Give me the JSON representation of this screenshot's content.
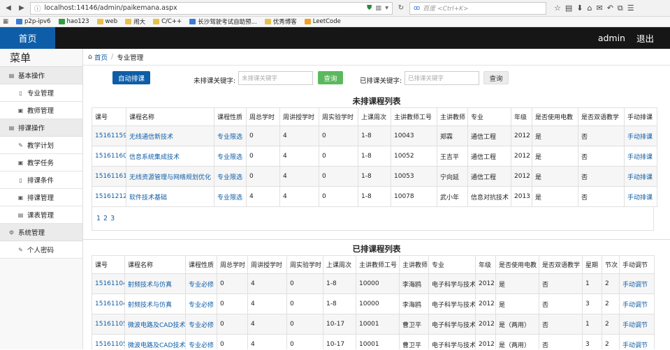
{
  "browser": {
    "url": "localhost:14146/admin/paikemana.aspx",
    "search_placeholder": "百度 <Ctrl+K>"
  },
  "bookmarks": [
    {
      "label": "p2p-ipv6",
      "color": "#3a7bd5"
    },
    {
      "label": "hao123",
      "color": "#2e9e3e"
    },
    {
      "label": "web",
      "color": "#e8c04a"
    },
    {
      "label": "闹大",
      "color": "#e8c04a"
    },
    {
      "label": "C/C++",
      "color": "#e8c04a"
    },
    {
      "label": "长沙驾驶考试自助预...",
      "color": "#3a7bd5"
    },
    {
      "label": "优秀博客",
      "color": "#e8c04a"
    },
    {
      "label": "LeetCode",
      "color": "#f0a020"
    }
  ],
  "topbar": {
    "home": "首页",
    "admin": "admin",
    "logout": "退出"
  },
  "sidebar": {
    "title": "菜单",
    "groups": [
      {
        "label": "基本操作",
        "icon": "list-icon",
        "items": [
          {
            "label": "专业管理",
            "icon": "file-icon"
          },
          {
            "label": "教师管理",
            "icon": "book-icon"
          }
        ]
      },
      {
        "label": "排课操作",
        "icon": "list-icon",
        "items": [
          {
            "label": "教学计划",
            "icon": "wrench-icon"
          },
          {
            "label": "教学任务",
            "icon": "book-icon"
          },
          {
            "label": "排课条件",
            "icon": "file-icon"
          },
          {
            "label": "排课管理",
            "icon": "book-icon"
          },
          {
            "label": "课表管理",
            "icon": "list-icon"
          }
        ]
      },
      {
        "label": "系统管理",
        "icon": "gear-icon",
        "items": [
          {
            "label": "个人密码",
            "icon": "wrench-icon"
          }
        ]
      }
    ]
  },
  "breadcrumb": {
    "home": "首页",
    "sep": "/",
    "current": "专业管理"
  },
  "controls": {
    "auto_btn": "自动排课",
    "unsched_label": "未排课关键字:",
    "unsched_placeholder": "未排课关键字",
    "query1": "查询",
    "sched_label": "已排课关键字:",
    "sched_placeholder": "已排课关键字",
    "query2": "查询"
  },
  "unscheduled": {
    "title": "未排课程列表",
    "headers": [
      "课号",
      "课程名称",
      "课程性质",
      "周总学时",
      "周讲授学时",
      "周实验学时",
      "上课周次",
      "主讲教师工号",
      "主讲教师",
      "专业",
      "年级",
      "是否使用电教",
      "是否双语教学",
      "手动排课"
    ],
    "rows": [
      [
        "15161159",
        "无线通信新技术",
        "专业限选",
        "0",
        "4",
        "0",
        "1-8",
        "10043",
        "郑霖",
        "通信工程",
        "2012",
        "是",
        "否",
        "手动排课"
      ],
      [
        "15161160",
        "信息系统集成技术",
        "专业限选",
        "0",
        "4",
        "0",
        "1-8",
        "10052",
        "王吉平",
        "通信工程",
        "2012",
        "是",
        "否",
        "手动排课"
      ],
      [
        "15161161",
        "无线资源管理与网络规划优化",
        "专业限选",
        "0",
        "4",
        "0",
        "1-8",
        "10053",
        "宁向延",
        "通信工程",
        "2012",
        "是",
        "否",
        "手动排课"
      ],
      [
        "15161212",
        "软件技术基础",
        "专业限选",
        "4",
        "4",
        "0",
        "1-8",
        "10078",
        "武小年",
        "信息对抗技术",
        "2013",
        "是",
        "否",
        "手动排课"
      ]
    ],
    "pages": [
      "1",
      "2",
      "3"
    ]
  },
  "scheduled": {
    "title": "已排课程列表",
    "headers": [
      "课号",
      "课程名称",
      "课程性质",
      "周总学时",
      "周讲授学时",
      "周实验学时",
      "上课周次",
      "主讲教师工号",
      "主讲教师",
      "专业",
      "年级",
      "是否使用电教",
      "是否双语教学",
      "星期",
      "节次",
      "手动调节"
    ],
    "rows": [
      [
        "15161104",
        "射频技术与仿真",
        "专业必修",
        "0",
        "4",
        "0",
        "1-8",
        "10000",
        "李海鸥",
        "电子科学与技术",
        "2012",
        "是",
        "否",
        "1",
        "2",
        "手动调节"
      ],
      [
        "15161104",
        "射频技术与仿真",
        "专业必修",
        "0",
        "4",
        "0",
        "1-8",
        "10000",
        "李海鸥",
        "电子科学与技术",
        "2012",
        "是",
        "否",
        "3",
        "2",
        "手动调节"
      ],
      [
        "15161105",
        "微波电路及CAD技术",
        "专业必修",
        "0",
        "4",
        "0",
        "10-17",
        "10001",
        "曹卫平",
        "电子科学与技术",
        "2012",
        "是（两用）",
        "否",
        "1",
        "2",
        "手动调节"
      ],
      [
        "15161105",
        "微波电路及CAD技术",
        "专业必修",
        "0",
        "4",
        "0",
        "10-17",
        "10001",
        "曹卫平",
        "电子科学与技术",
        "2012",
        "是（两用）",
        "否",
        "3",
        "2",
        "手动调节"
      ]
    ]
  }
}
